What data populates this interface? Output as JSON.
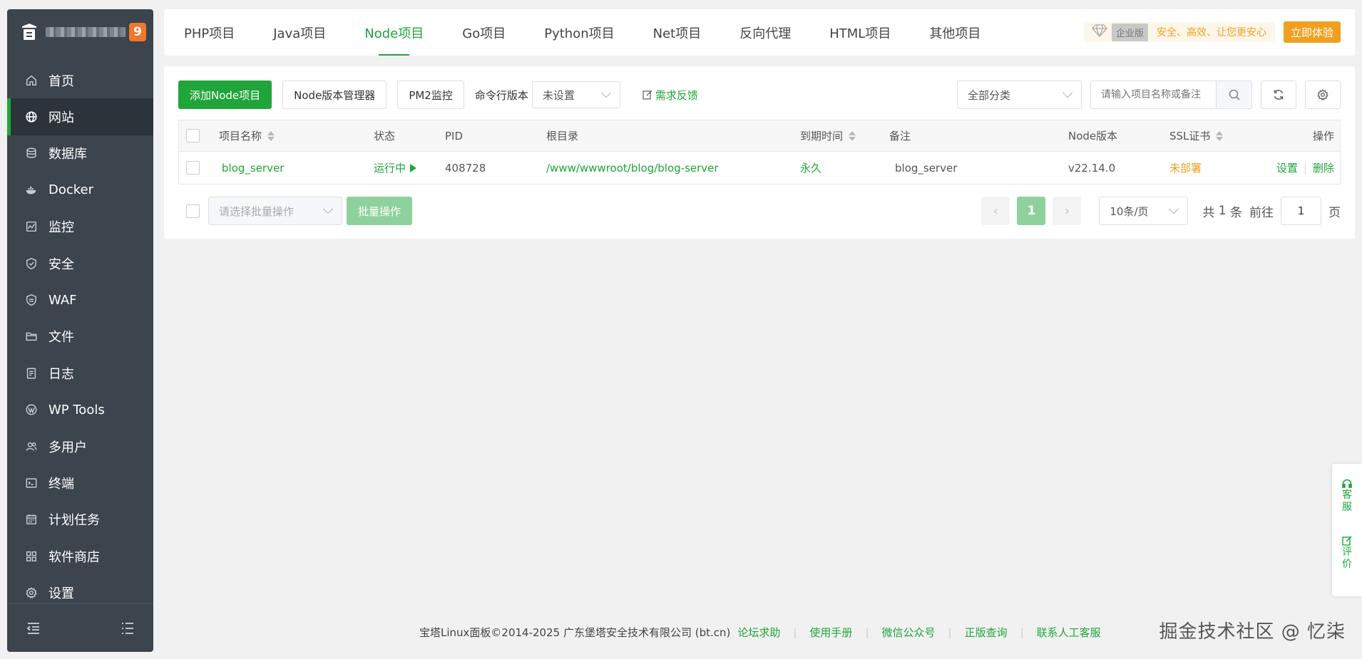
{
  "sidebar": {
    "badge": "9",
    "items": [
      {
        "label": "首页",
        "icon": "home-icon"
      },
      {
        "label": "网站",
        "icon": "globe-icon",
        "active": true
      },
      {
        "label": "数据库",
        "icon": "database-icon"
      },
      {
        "label": "Docker",
        "icon": "docker-icon"
      },
      {
        "label": "监控",
        "icon": "monitor-icon"
      },
      {
        "label": "安全",
        "icon": "shield-icon"
      },
      {
        "label": "WAF",
        "icon": "waf-shield-icon"
      },
      {
        "label": "文件",
        "icon": "folder-icon"
      },
      {
        "label": "日志",
        "icon": "log-icon"
      },
      {
        "label": "WP Tools",
        "icon": "wordpress-icon"
      },
      {
        "label": "多用户",
        "icon": "users-icon"
      },
      {
        "label": "终端",
        "icon": "terminal-icon"
      },
      {
        "label": "计划任务",
        "icon": "calendar-icon"
      },
      {
        "label": "软件商店",
        "icon": "apps-icon"
      },
      {
        "label": "设置",
        "icon": "gear-icon"
      }
    ]
  },
  "tabs": [
    {
      "label": "PHP项目"
    },
    {
      "label": "Java项目"
    },
    {
      "label": "Node项目",
      "active": true
    },
    {
      "label": "Go项目"
    },
    {
      "label": "Python项目"
    },
    {
      "label": "Net项目"
    },
    {
      "label": "反向代理"
    },
    {
      "label": "HTML项目"
    },
    {
      "label": "其他项目"
    }
  ],
  "promo": {
    "edition_tag": "企业版",
    "slogan": "安全、高效、让您更安心",
    "try_button": "立即体验"
  },
  "toolbar": {
    "add_button": "添加Node项目",
    "version_manager": "Node版本管理器",
    "pm2_monitor": "PM2监控",
    "cli_version_label": "命令行版本",
    "cli_version_value": "未设置",
    "feedback": "需求反馈",
    "category_value": "全部分类",
    "search_placeholder": "请输入项目名称或备注"
  },
  "table": {
    "headers": {
      "name": "项目名称",
      "status": "状态",
      "pid": "PID",
      "root": "根目录",
      "expire": "到期时间",
      "remark": "备注",
      "node_version": "Node版本",
      "ssl": "SSL证书",
      "actions": "操作"
    },
    "rows": [
      {
        "name": "blog_server",
        "status": "运行中",
        "pid": "408728",
        "root": "/www/wwwroot/blog/blog-server",
        "expire": "永久",
        "remark": "blog_server",
        "node_version": "v22.14.0",
        "ssl": "未部署",
        "action_settings": "设置",
        "action_delete": "删除"
      }
    ]
  },
  "batch": {
    "select_placeholder": "请选择批量操作",
    "button": "批量操作"
  },
  "pagination": {
    "current_page": "1",
    "page_size": "10条/页",
    "total_prefix": "共",
    "total": "1",
    "total_suffix": "条",
    "goto_label": "前往",
    "goto_value": "1",
    "page_suffix": "页"
  },
  "footer": {
    "copyright": "宝塔Linux面板©2014-2025 广东堡塔安全技术有限公司 (bt.cn)",
    "links": [
      "论坛求助",
      "使用手册",
      "微信公众号",
      "正版查询",
      "联系人工客服"
    ],
    "watermark": "掘金技术社区 @ 忆柒"
  },
  "float_panel": {
    "service": "客服",
    "review": "评价"
  },
  "colors": {
    "accent": "#20a53a",
    "sidebar_bg": "#3c444d",
    "warning": "#f0a020"
  }
}
